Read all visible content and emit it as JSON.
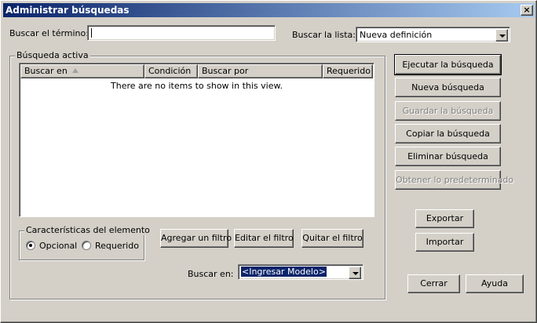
{
  "window": {
    "title": "Administrar búsquedas",
    "close_glyph": "×"
  },
  "search": {
    "term_label": "Buscar el término:",
    "term_value": "",
    "list_label": "Buscar la lista:",
    "list_selected": "Nueva definición"
  },
  "active_search": {
    "legend": "Búsqueda activa",
    "columns": [
      "Buscar en",
      "Condición",
      "Buscar por",
      "Requerido"
    ],
    "empty_message": "There are no items to show in this view."
  },
  "element_features": {
    "legend": "Características del elemento",
    "options": [
      {
        "label": "Opcional",
        "checked": true
      },
      {
        "label": "Requerido",
        "checked": false
      }
    ]
  },
  "filter_buttons": {
    "add": "Agregar un filtro",
    "edit": "Editar el filtro",
    "remove": "Quitar el filtro"
  },
  "search_in": {
    "label": "Buscar en:",
    "selected": "<Ingresar Modelo>"
  },
  "actions": {
    "run": "Ejecutar la búsqueda",
    "new": "Nueva búsqueda",
    "save": "Guardar la búsqueda",
    "copy": "Copiar la búsqueda",
    "delete": "Eliminar búsqueda",
    "defaults": "Obtener lo predeterminado",
    "export": "Exportar",
    "import": "Importar",
    "close": "Cerrar",
    "help": "Ayuda"
  },
  "colors": {
    "face": "#d4d0c8",
    "title_gradient_start": "#0a246a",
    "title_gradient_end": "#a6caf0",
    "selection": "#0a246a",
    "disabled_text": "#808080"
  }
}
